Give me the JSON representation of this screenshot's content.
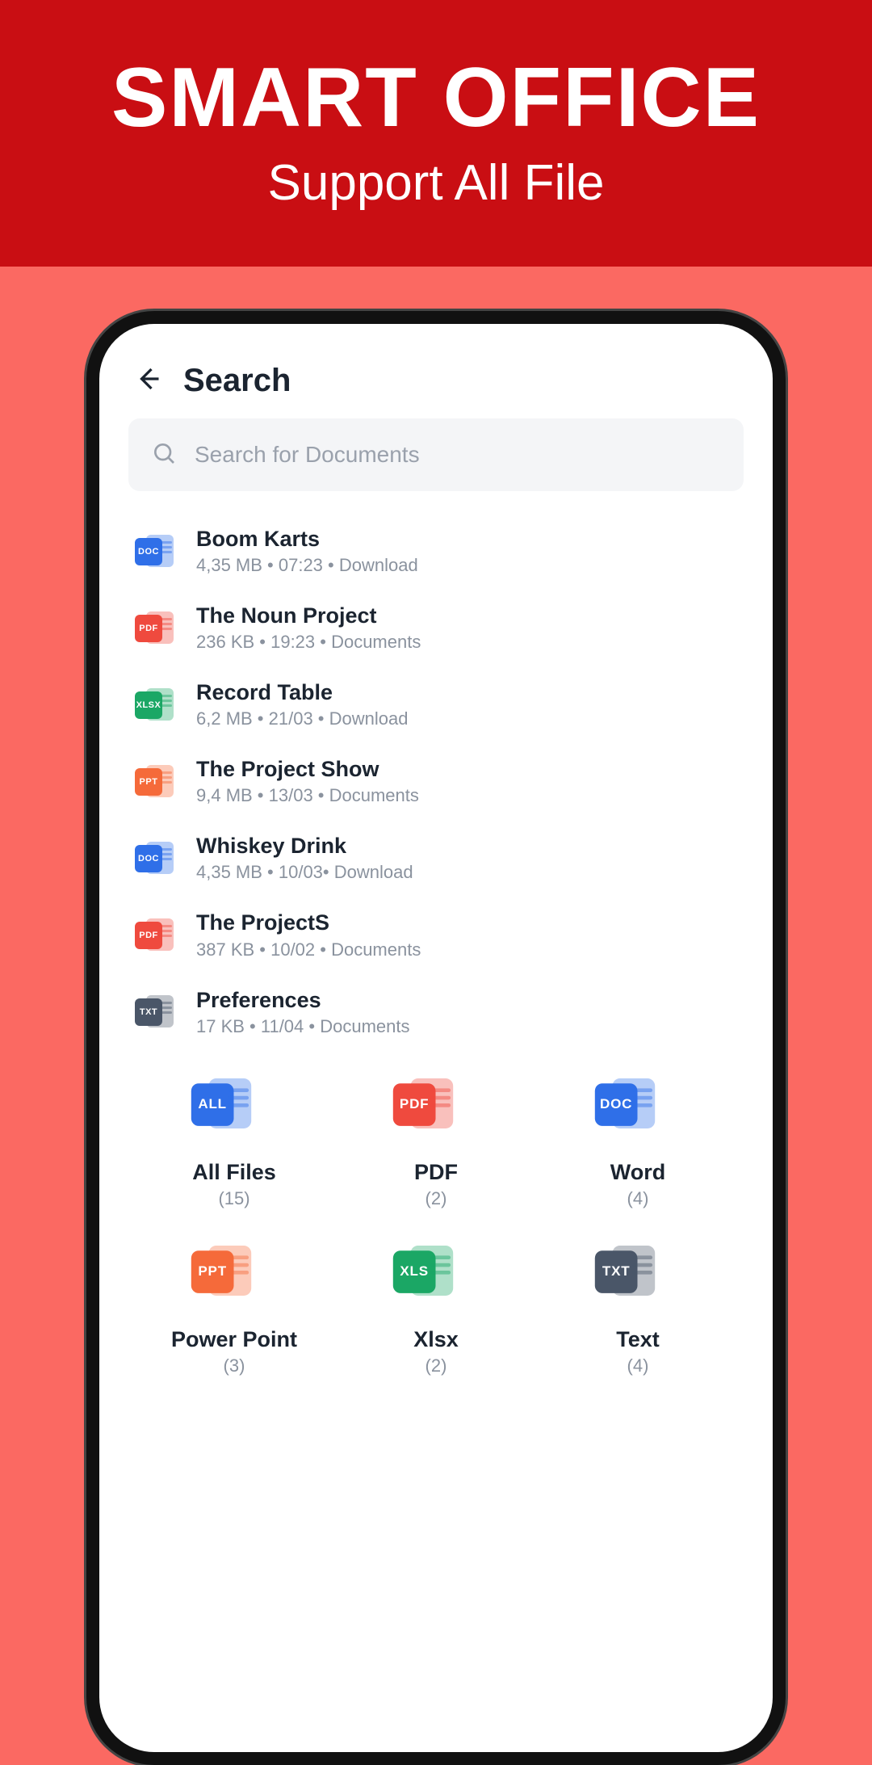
{
  "banner": {
    "title": "SMART OFFICE",
    "subtitle": "Support All File"
  },
  "header": {
    "title": "Search"
  },
  "search": {
    "placeholder": "Search for Documents"
  },
  "colors": {
    "doc": "#2f6fe8",
    "pdf": "#ef4a3e",
    "xlsx": "#1ba765",
    "ppt": "#f56a3a",
    "txt": "#4a5668",
    "all": "#2f6fe8"
  },
  "files": [
    {
      "type": "doc",
      "label": "DOC",
      "name": "Boom Karts",
      "meta": "4,35 MB • 07:23 • Download"
    },
    {
      "type": "pdf",
      "label": "PDF",
      "name": "The Noun Project",
      "meta": "236 KB • 19:23 • Documents"
    },
    {
      "type": "xlsx",
      "label": "XLSX",
      "name": "Record Table",
      "meta": "6,2 MB • 21/03 • Download"
    },
    {
      "type": "ppt",
      "label": "PPT",
      "name": "The Project Show",
      "meta": "9,4 MB • 13/03 • Documents"
    },
    {
      "type": "doc",
      "label": "DOC",
      "name": "Whiskey Drink",
      "meta": "4,35 MB • 10/03• Download"
    },
    {
      "type": "pdf",
      "label": "PDF",
      "name": "The ProjectS",
      "meta": "387 KB • 10/02 • Documents"
    },
    {
      "type": "txt",
      "label": "TXT",
      "name": "Preferences",
      "meta": "17 KB • 11/04 • Documents"
    }
  ],
  "categories": [
    {
      "type": "all",
      "label": "ALL",
      "name": "All Files",
      "count": "(15)"
    },
    {
      "type": "pdf",
      "label": "PDF",
      "name": "PDF",
      "count": "(2)"
    },
    {
      "type": "doc",
      "label": "DOC",
      "name": "Word",
      "count": "(4)"
    },
    {
      "type": "ppt",
      "label": "PPT",
      "name": "Power Point",
      "count": "(3)"
    },
    {
      "type": "xlsx",
      "label": "XLS",
      "name": "Xlsx",
      "count": "(2)"
    },
    {
      "type": "txt",
      "label": "TXT",
      "name": "Text",
      "count": "(4)"
    }
  ]
}
